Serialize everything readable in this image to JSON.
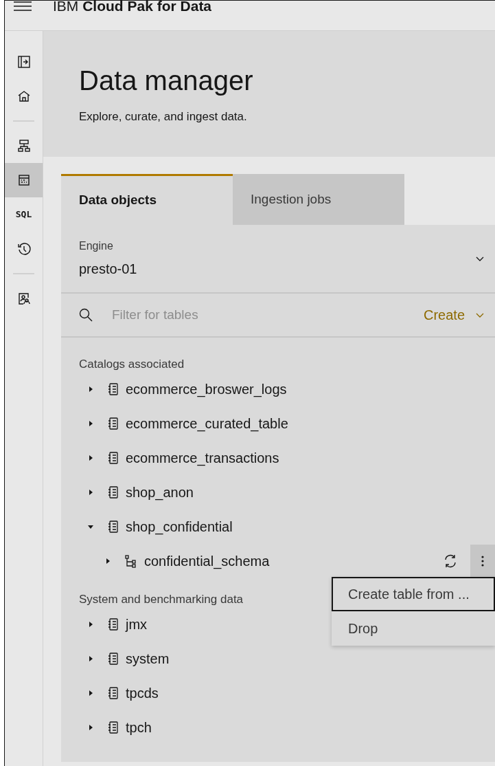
{
  "header": {
    "brand_plain": "IBM",
    "brand_bold": "Cloud Pak for Data"
  },
  "rail": {
    "items": [
      {
        "kind": "panel",
        "selected": false
      },
      {
        "kind": "home",
        "selected": false
      },
      {
        "kind": "separator"
      },
      {
        "kind": "hierarchy",
        "selected": false
      },
      {
        "kind": "calendar",
        "selected": true
      },
      {
        "kind": "label",
        "label": "SQL",
        "selected": false
      },
      {
        "kind": "history",
        "selected": false
      },
      {
        "kind": "separator"
      },
      {
        "kind": "access",
        "selected": false
      }
    ]
  },
  "banner": {
    "title": "Data manager",
    "subtitle": "Explore, curate, and ingest data."
  },
  "tabs": [
    {
      "label": "Data objects",
      "selected": true
    },
    {
      "label": "Ingestion jobs",
      "selected": false
    }
  ],
  "engine": {
    "label": "Engine",
    "value": "presto-01"
  },
  "search": {
    "placeholder": "Filter for tables"
  },
  "create_button": {
    "label": "Create"
  },
  "sections": [
    {
      "title": "Catalogs associated",
      "items": [
        {
          "name": "ecommerce_broswer_logs",
          "expanded": false
        },
        {
          "name": "ecommerce_curated_table",
          "expanded": false
        },
        {
          "name": "ecommerce_transactions",
          "expanded": false
        },
        {
          "name": "shop_anon",
          "expanded": false
        },
        {
          "name": "shop_confidential",
          "expanded": true,
          "children": [
            {
              "name": "confidential_schema",
              "expanded": false,
              "menu_open": true
            }
          ]
        }
      ]
    },
    {
      "title": "System and benchmarking data",
      "items": [
        {
          "name": "jmx",
          "expanded": false
        },
        {
          "name": "system",
          "expanded": false
        },
        {
          "name": "tpcds",
          "expanded": false
        },
        {
          "name": "tpch",
          "expanded": false
        }
      ]
    }
  ],
  "context_menu": {
    "items": [
      {
        "label": "Create table from ...",
        "selected": true
      },
      {
        "label": "Drop",
        "selected": false
      }
    ]
  }
}
